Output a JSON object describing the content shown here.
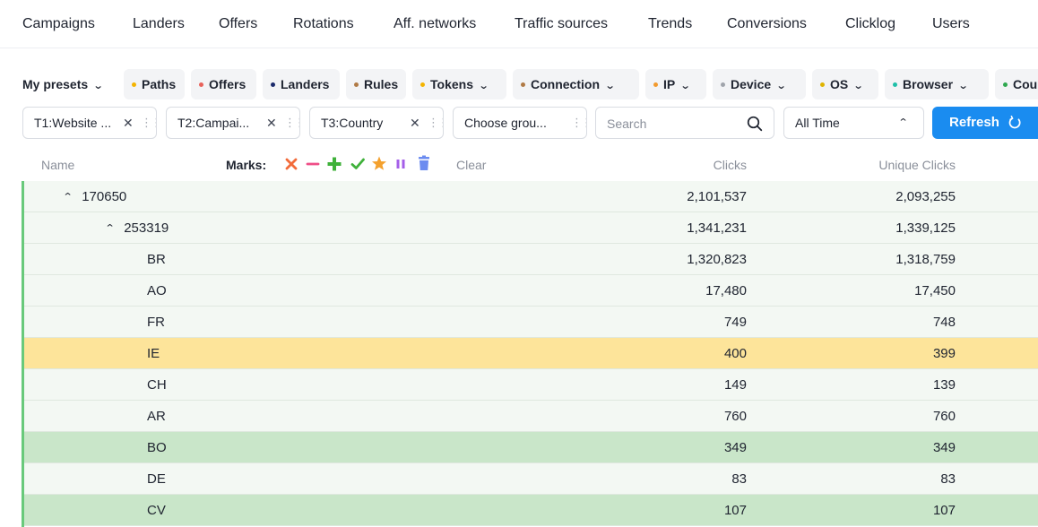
{
  "nav": [
    "Campaigns",
    "Landers",
    "Offers",
    "Rotations",
    "Aff. networks",
    "Traffic sources",
    "Trends",
    "Conversions",
    "Clicklog",
    "Users"
  ],
  "presets": {
    "label": "My presets",
    "chips": [
      {
        "label": "Paths",
        "dot": "#f4b400",
        "chevron": false
      },
      {
        "label": "Offers",
        "dot": "#e8625a",
        "chevron": false
      },
      {
        "label": "Landers",
        "dot": "#1b2a6b",
        "chevron": false
      },
      {
        "label": "Rules",
        "dot": "#b07a45",
        "chevron": false
      },
      {
        "label": "Tokens",
        "dot": "#f4b400",
        "chevron": true
      },
      {
        "label": "Connection",
        "dot": "#b07a45",
        "chevron": true
      },
      {
        "label": "IP",
        "dot": "#f29a2e",
        "chevron": true
      },
      {
        "label": "Device",
        "dot": "#a0a4ab",
        "chevron": true
      },
      {
        "label": "OS",
        "dot": "#e0b400",
        "chevron": true
      },
      {
        "label": "Browser",
        "dot": "#1fbfa8",
        "chevron": true
      },
      {
        "label": "Cou",
        "dot": "#2fa84f",
        "chevron": false
      }
    ]
  },
  "groupings": [
    "T1:Website ...",
    "T2:Campai...",
    "T3:Country",
    "Choose grou..."
  ],
  "search": {
    "placeholder": "Search"
  },
  "time_range": "All Time",
  "refresh_label": "Refresh",
  "table": {
    "col_name": "Name",
    "marks_label": "Marks:",
    "clear_label": "Clear",
    "col_clicks": "Clicks",
    "col_unique": "Unique Clicks",
    "mark_icons": [
      {
        "name": "x-mark-icon",
        "color": "#f26b3a"
      },
      {
        "name": "minus-mark-icon",
        "color": "#ef4f87"
      },
      {
        "name": "plus-mark-icon",
        "color": "#3fb13a"
      },
      {
        "name": "check-mark-icon",
        "color": "#3fb13a"
      },
      {
        "name": "star-mark-icon",
        "color": "#f4a12e"
      },
      {
        "name": "pause-mark-icon",
        "color": "#a45ee8"
      },
      {
        "name": "trash-mark-icon",
        "color": "#6c8cf0"
      }
    ],
    "rows": [
      {
        "name": "170650",
        "clicks": "2,101,537",
        "unique": "2,093,255",
        "level": 0,
        "expanded": true,
        "bg": "#f3f8f3"
      },
      {
        "name": "253319",
        "clicks": "1,341,231",
        "unique": "1,339,125",
        "level": 1,
        "expanded": true,
        "bg": "#f3f8f3"
      },
      {
        "name": "BR",
        "clicks": "1,320,823",
        "unique": "1,318,759",
        "level": 2,
        "bg": "#f3f8f3"
      },
      {
        "name": "AO",
        "clicks": "17,480",
        "unique": "17,450",
        "level": 2,
        "bg": "#f3f8f3"
      },
      {
        "name": "FR",
        "clicks": "749",
        "unique": "748",
        "level": 2,
        "bg": "#f3f8f3"
      },
      {
        "name": "IE",
        "clicks": "400",
        "unique": "399",
        "level": 2,
        "bg": "#fde49a"
      },
      {
        "name": "CH",
        "clicks": "149",
        "unique": "139",
        "level": 2,
        "bg": "#f3f8f3"
      },
      {
        "name": "AR",
        "clicks": "760",
        "unique": "760",
        "level": 2,
        "bg": "#f3f8f3"
      },
      {
        "name": "BO",
        "clicks": "349",
        "unique": "349",
        "level": 2,
        "bg": "#c9e6c9"
      },
      {
        "name": "DE",
        "clicks": "83",
        "unique": "83",
        "level": 2,
        "bg": "#f3f8f3"
      },
      {
        "name": "CV",
        "clicks": "107",
        "unique": "107",
        "level": 2,
        "bg": "#c9e6c9"
      }
    ]
  }
}
